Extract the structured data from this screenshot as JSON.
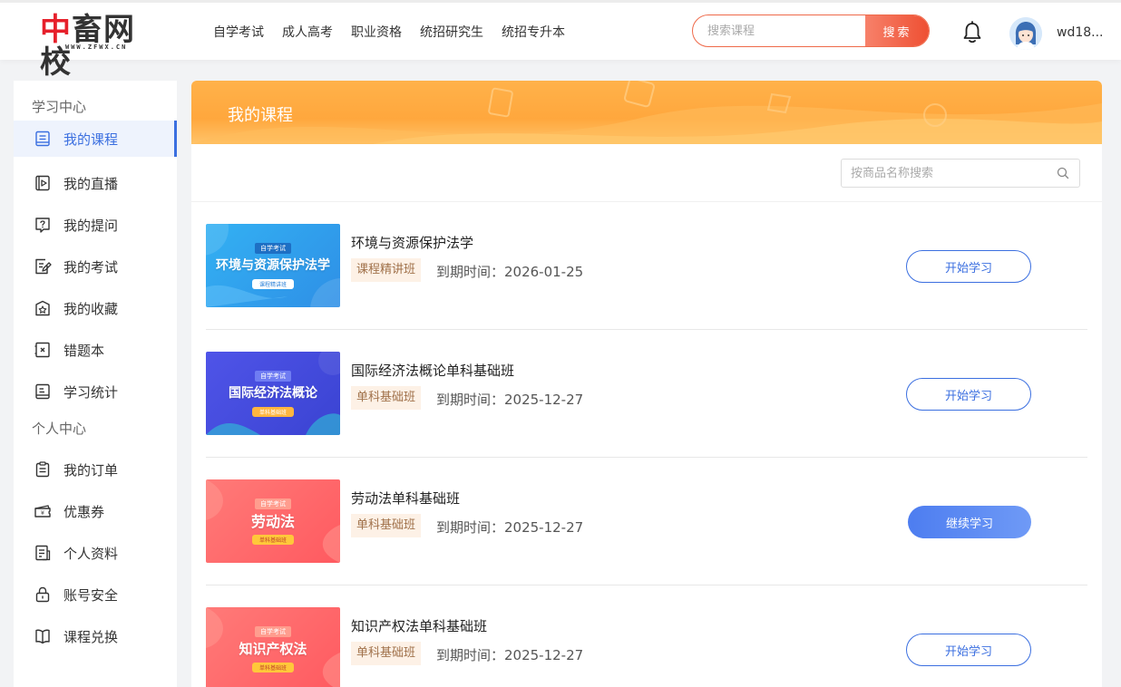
{
  "header": {
    "logo_main_a": "中",
    "logo_main_b": "畜网校",
    "logo_sub": "WWW.ZFWX.CN",
    "nav": [
      "自学考试",
      "成人高考",
      "职业资格",
      "统招研究生",
      "统招专升本"
    ],
    "search_placeholder": "搜索课程",
    "search_button": "搜索",
    "username": "wd18..."
  },
  "sidebar": {
    "section1_title": "学习中心",
    "section1_items": [
      {
        "label": "我的课程",
        "icon": "book-icon",
        "active": true
      },
      {
        "label": "我的直播",
        "icon": "live-play-icon"
      },
      {
        "label": "我的提问",
        "icon": "question-icon"
      },
      {
        "label": "我的考试",
        "icon": "exam-edit-icon"
      },
      {
        "label": "我的收藏",
        "icon": "star-box-icon"
      },
      {
        "label": "错题本",
        "icon": "wrong-book-icon"
      },
      {
        "label": "学习统计",
        "icon": "stats-list-icon"
      }
    ],
    "section2_title": "个人中心",
    "section2_items": [
      {
        "label": "我的订单",
        "icon": "order-clipboard-icon"
      },
      {
        "label": "优惠券",
        "icon": "coupon-icon"
      },
      {
        "label": "个人资料",
        "icon": "profile-doc-icon"
      },
      {
        "label": "账号安全",
        "icon": "lock-icon"
      },
      {
        "label": "课程兑换",
        "icon": "exchange-book-icon"
      }
    ]
  },
  "main": {
    "banner_title": "我的课程",
    "course_search_placeholder": "按商品名称搜索",
    "courses": [
      {
        "name": "环境与资源保护法学",
        "type": "课程精讲班",
        "expire": "到期时间：2026-01-25",
        "button": "开始学习",
        "cover_tag": "自学考试",
        "cover_title": "环境与资源保护法学",
        "cover_sub": "课程精讲班"
      },
      {
        "name": "国际经济法概论单科基础班",
        "type": "单科基础班",
        "expire": "到期时间：2025-12-27",
        "button": "开始学习",
        "cover_tag": "自学考试",
        "cover_title": "国际经济法概论",
        "cover_sub": "单科基础班"
      },
      {
        "name": "劳动法单科基础班",
        "type": "单科基础班",
        "expire": "到期时间：2025-12-27",
        "button": "继续学习",
        "cover_tag": "自学考试",
        "cover_title": "劳动法",
        "cover_sub": "单科基础班"
      },
      {
        "name": "知识产权法单科基础班",
        "type": "单科基础班",
        "expire": "到期时间：2025-12-27",
        "button": "开始学习",
        "cover_tag": "自学考试",
        "cover_title": "知识产权法",
        "cover_sub": "单科基础班"
      }
    ]
  },
  "colors": {
    "accent_blue": "#3b6fe0",
    "search_red": "#ee4f32",
    "banner_orange": "#ffa73d",
    "cover_blue": "#2e9be8",
    "cover_indigo": "#4a4ee0",
    "cover_red": "#ff6468"
  }
}
